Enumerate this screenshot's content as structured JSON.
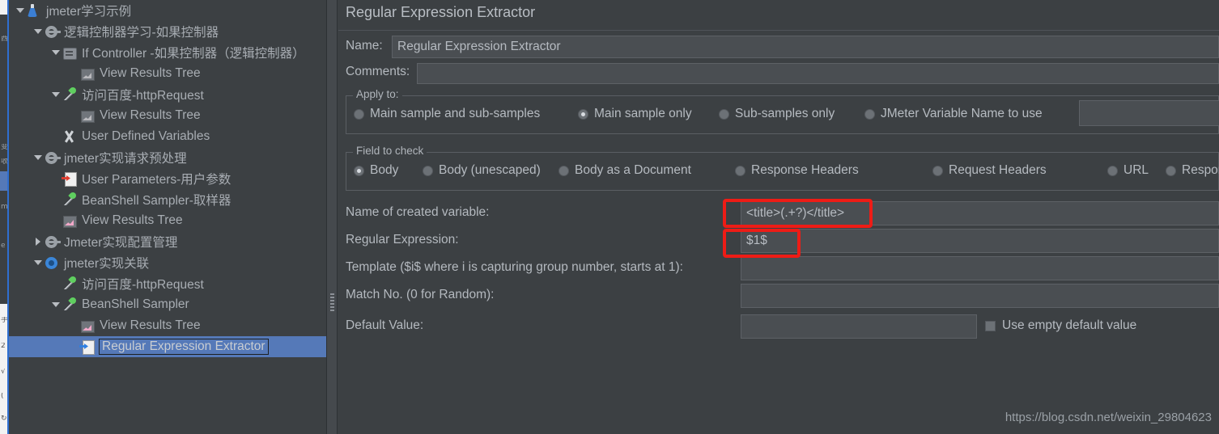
{
  "window": {
    "background_color": "#3c4043",
    "selection_color": "#5579b8",
    "annotation_color": "#ee1c16"
  },
  "tree": {
    "nodes": [
      {
        "label": "jmeter学习示例",
        "icon": "flask-icon",
        "twisty": "down",
        "depth": 0,
        "selected": false
      },
      {
        "label": "逻辑控制器学习-如果控制器",
        "icon": "gear-icon",
        "twisty": "down",
        "depth": 1,
        "selected": false
      },
      {
        "label": "If Controller  -如果控制器（逻辑控制器）",
        "icon": "if-controller-icon",
        "twisty": "down",
        "depth": 2,
        "selected": false
      },
      {
        "label": "View Results Tree",
        "icon": "chart-icon",
        "twisty": "none",
        "depth": 3,
        "selected": false
      },
      {
        "label": "访问百度-httpRequest",
        "icon": "pipette-icon",
        "twisty": "down",
        "depth": 2,
        "selected": false
      },
      {
        "label": "View Results Tree",
        "icon": "chart-icon",
        "twisty": "none",
        "depth": 3,
        "selected": false
      },
      {
        "label": "User Defined Variables",
        "icon": "tools-icon",
        "twisty": "none",
        "depth": 2,
        "selected": false
      },
      {
        "label": "jmeter实现请求预处理",
        "icon": "gear-icon",
        "twisty": "down",
        "depth": 1,
        "selected": false
      },
      {
        "label": "User Parameters-用户参数",
        "icon": "page-red-arrow-icon",
        "twisty": "none",
        "depth": 2,
        "selected": false
      },
      {
        "label": "BeanShell Sampler-取样器",
        "icon": "pipette-icon",
        "twisty": "none",
        "depth": 2,
        "selected": false
      },
      {
        "label": "View Results Tree",
        "icon": "chart-pink-icon",
        "twisty": "none",
        "depth": 2,
        "selected": false
      },
      {
        "label": "Jmeter实现配置管理",
        "icon": "gear-icon",
        "twisty": "right",
        "depth": 1,
        "selected": false
      },
      {
        "label": "jmeter实现关联",
        "icon": "gear-blue-icon",
        "twisty": "down",
        "depth": 1,
        "selected": false
      },
      {
        "label": "访问百度-httpRequest",
        "icon": "pipette-icon",
        "twisty": "none",
        "depth": 2,
        "selected": false
      },
      {
        "label": "BeanShell Sampler",
        "icon": "pipette-icon",
        "twisty": "down",
        "depth": 2,
        "selected": false
      },
      {
        "label": "View Results Tree",
        "icon": "chart-pink-icon",
        "twisty": "none",
        "depth": 3,
        "selected": false
      },
      {
        "label": "Regular Expression Extractor",
        "icon": "page-blue-arrow-icon",
        "twisty": "none",
        "depth": 3,
        "selected": true
      }
    ]
  },
  "panel": {
    "title": "Regular Expression Extractor",
    "name_label": "Name:",
    "name_value": "Regular Expression Extractor",
    "comments_label": "Comments:",
    "comments_value": "",
    "apply_to": {
      "group_title": "Apply to:",
      "options": [
        {
          "label": "Main sample and sub-samples",
          "selected": false
        },
        {
          "label": "Main sample only",
          "selected": true
        },
        {
          "label": "Sub-samples only",
          "selected": false
        },
        {
          "label": "JMeter Variable Name to use",
          "selected": false
        }
      ],
      "variable_name_value": ""
    },
    "field_to_check": {
      "group_title": "Field to check",
      "options": [
        {
          "label": "Body",
          "selected": true
        },
        {
          "label": "Body (unescaped)",
          "selected": false
        },
        {
          "label": "Body as a Document",
          "selected": false
        },
        {
          "label": "Response Headers",
          "selected": false
        },
        {
          "label": "Request Headers",
          "selected": false
        },
        {
          "label": "URL",
          "selected": false
        },
        {
          "label": "Response Code",
          "selected": false
        }
      ]
    },
    "fields": [
      {
        "label": "Name of created variable:",
        "value": "<title>(.+?)</title>",
        "highlighted": true
      },
      {
        "label": "Regular Expression:",
        "value": "$1$",
        "highlighted": true
      },
      {
        "label": "Template ($i$ where i is capturing group number, starts at 1):",
        "value": "",
        "highlighted": false
      },
      {
        "label": "Match No. (0 for Random):",
        "value": "",
        "highlighted": false
      },
      {
        "label": "Default Value:",
        "value": "",
        "highlighted": false
      }
    ],
    "use_empty_default_value": {
      "label": "Use empty default value",
      "checked": false
    }
  },
  "watermark": "https://blog.csdn.net/weixin_29804623",
  "left_sliver": {
    "fragments": [
      "指",
      "2",
      "√",
      "(",
      "↻"
    ]
  }
}
